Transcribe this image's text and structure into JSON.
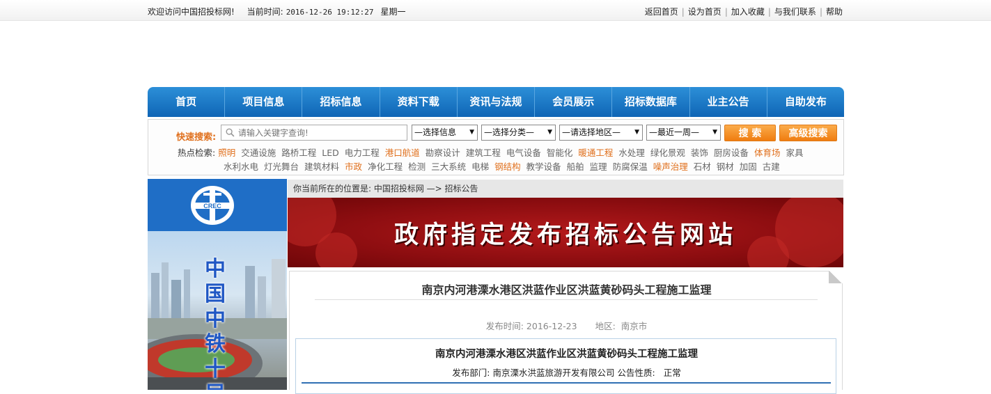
{
  "topbar": {
    "welcome": "欢迎访问中国招投标网!",
    "time_label": "当前时间:",
    "time_value": "2016-12-26 19:12:27",
    "weekday": "星期一",
    "links": [
      "返回首页",
      "设为首页",
      "加入收藏",
      "与我们联系",
      "帮助"
    ]
  },
  "nav": {
    "items": [
      "首页",
      "项目信息",
      "招标信息",
      "资料下载",
      "资讯与法规",
      "会员展示",
      "招标数据库",
      "业主公告",
      "自助发布"
    ]
  },
  "search": {
    "label": "快速搜索:",
    "placeholder": "请输入关键字查询!",
    "selects": [
      "—选择信息",
      "—选择分类—",
      "—请选择地区—",
      "—最近一周—"
    ],
    "search_button": "搜 索",
    "advanced_button": "高级搜索",
    "hot_label": "热点检索:",
    "hot_row1": [
      {
        "t": "照明",
        "hl": true
      },
      {
        "t": "交通设施",
        "hl": false
      },
      {
        "t": "路桥工程",
        "hl": false
      },
      {
        "t": "LED",
        "hl": false
      },
      {
        "t": "电力工程",
        "hl": false
      },
      {
        "t": "港口航道",
        "hl": true
      },
      {
        "t": "勘察设计",
        "hl": false
      },
      {
        "t": "建筑工程",
        "hl": false
      },
      {
        "t": "电气设备",
        "hl": false
      },
      {
        "t": "智能化",
        "hl": false
      },
      {
        "t": "暖通工程",
        "hl": true
      },
      {
        "t": "水处理",
        "hl": false
      },
      {
        "t": "绿化景观",
        "hl": false
      },
      {
        "t": "装饰",
        "hl": false
      },
      {
        "t": "厨房设备",
        "hl": false
      },
      {
        "t": "体育场",
        "hl": true
      },
      {
        "t": "家具",
        "hl": false
      }
    ],
    "hot_row2": [
      {
        "t": "水利水电",
        "hl": false
      },
      {
        "t": "灯光舞台",
        "hl": false
      },
      {
        "t": "建筑材料",
        "hl": false
      },
      {
        "t": "市政",
        "hl": true
      },
      {
        "t": "净化工程",
        "hl": false
      },
      {
        "t": "检测",
        "hl": false
      },
      {
        "t": "三大系统",
        "hl": false
      },
      {
        "t": "电梯",
        "hl": false
      },
      {
        "t": "钢结构",
        "hl": true
      },
      {
        "t": "教学设备",
        "hl": false
      },
      {
        "t": "船舶",
        "hl": false
      },
      {
        "t": "监理",
        "hl": false
      },
      {
        "t": "防腐保温",
        "hl": false
      },
      {
        "t": "噪声治理",
        "hl": true
      },
      {
        "t": "石材",
        "hl": false
      },
      {
        "t": "钢材",
        "hl": false
      },
      {
        "t": "加固",
        "hl": false
      },
      {
        "t": "古建",
        "hl": false
      }
    ]
  },
  "left_banner": {
    "logo_text": "CREC",
    "vertical_text": "中国中铁十局"
  },
  "breadcrumb": "你当前所在的位置是: 中国招投标网 —> 招标公告",
  "red_banner": "政府指定发布招标公告网站",
  "article": {
    "title": "南京内河港溧水港区洪蓝作业区洪蓝黄砂码头工程施工监理",
    "publish_label": "发布时间:",
    "publish_date": "2016-12-23",
    "region_label": "地区:",
    "region": "南京市",
    "detail_title": "南京内河港溧水港区洪蓝作业区洪蓝黄砂码头工程施工监理",
    "dept_label": "发布部门:",
    "dept": "南京溧水洪蓝旅游开发有限公司",
    "nature_label": "公告性质:",
    "nature": "正常"
  },
  "colors": {
    "nav_blue": "#1a76c9",
    "accent_orange": "#e0701d",
    "banner_red": "#9c1114"
  }
}
